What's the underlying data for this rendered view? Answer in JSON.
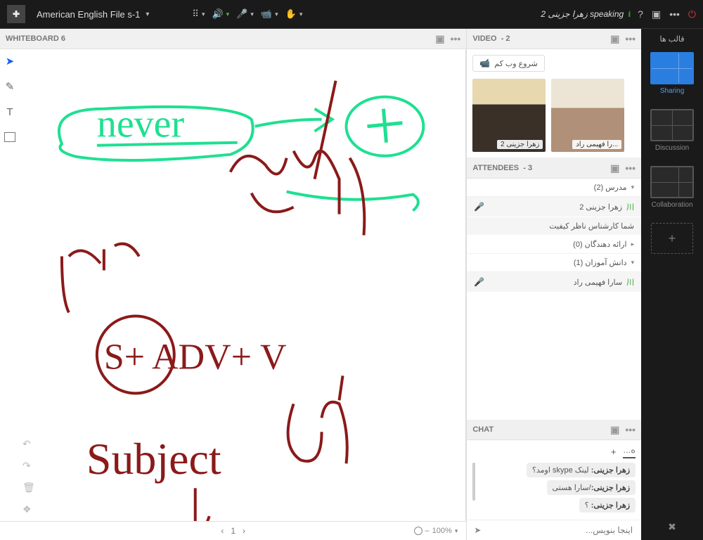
{
  "topbar": {
    "room_title": "American English File s-1",
    "status_text": "زهرا جزینی 2 speaking"
  },
  "whiteboard": {
    "title": "WHITEBOARD 6",
    "page_current": "1",
    "zoom_label": "100%",
    "words": {
      "never": "never",
      "subject": "Subject",
      "shadv": "S+ ADV+ V"
    }
  },
  "video": {
    "title": "VIDEO",
    "count": "- 2",
    "webcam_btn": "شروع وب کم",
    "tiles": [
      {
        "label": "زهرا جزینی 2"
      },
      {
        "label": "...را فهیمی راد"
      }
    ]
  },
  "attendees": {
    "title": "ATTENDEES",
    "count": "- 3",
    "groups": {
      "hosts_label": "مدرس (2)",
      "presenters_label": "ارائه دهندگان (0)",
      "participants_label": "دانش آموزان (1)"
    },
    "items": {
      "host1": "زهرا جزینی 2",
      "host2": "شما  کارشناس ناظر کیفیت",
      "participant1": "سارا فهیمی راد"
    }
  },
  "chat": {
    "title": "CHAT",
    "tab_everyone": "ه...",
    "messages": [
      {
        "author": "زهرا جزینی:",
        "text": "لینک skype اومد؟"
      },
      {
        "author": "زهرا جزینی:",
        "text": "/سارا هستی"
      },
      {
        "author": "زهرا جزینی:",
        "text": "؟"
      }
    ],
    "input_placeholder": "اینجا بنویس..."
  },
  "sidebar": {
    "title": "قالب ها",
    "layouts": [
      {
        "label": "Sharing"
      },
      {
        "label": "Discussion"
      },
      {
        "label": "Collaboration"
      }
    ]
  },
  "icons": {
    "grid": "⠿",
    "speaker": "🔊",
    "mic": "🎤",
    "cam": "📹",
    "hand": "✋",
    "help": "?",
    "full": "▣",
    "more": "•••",
    "power": "⏻",
    "trash": "🗑",
    "undo": "↶",
    "redo": "↷",
    "layers": "❖",
    "send": "➤"
  }
}
